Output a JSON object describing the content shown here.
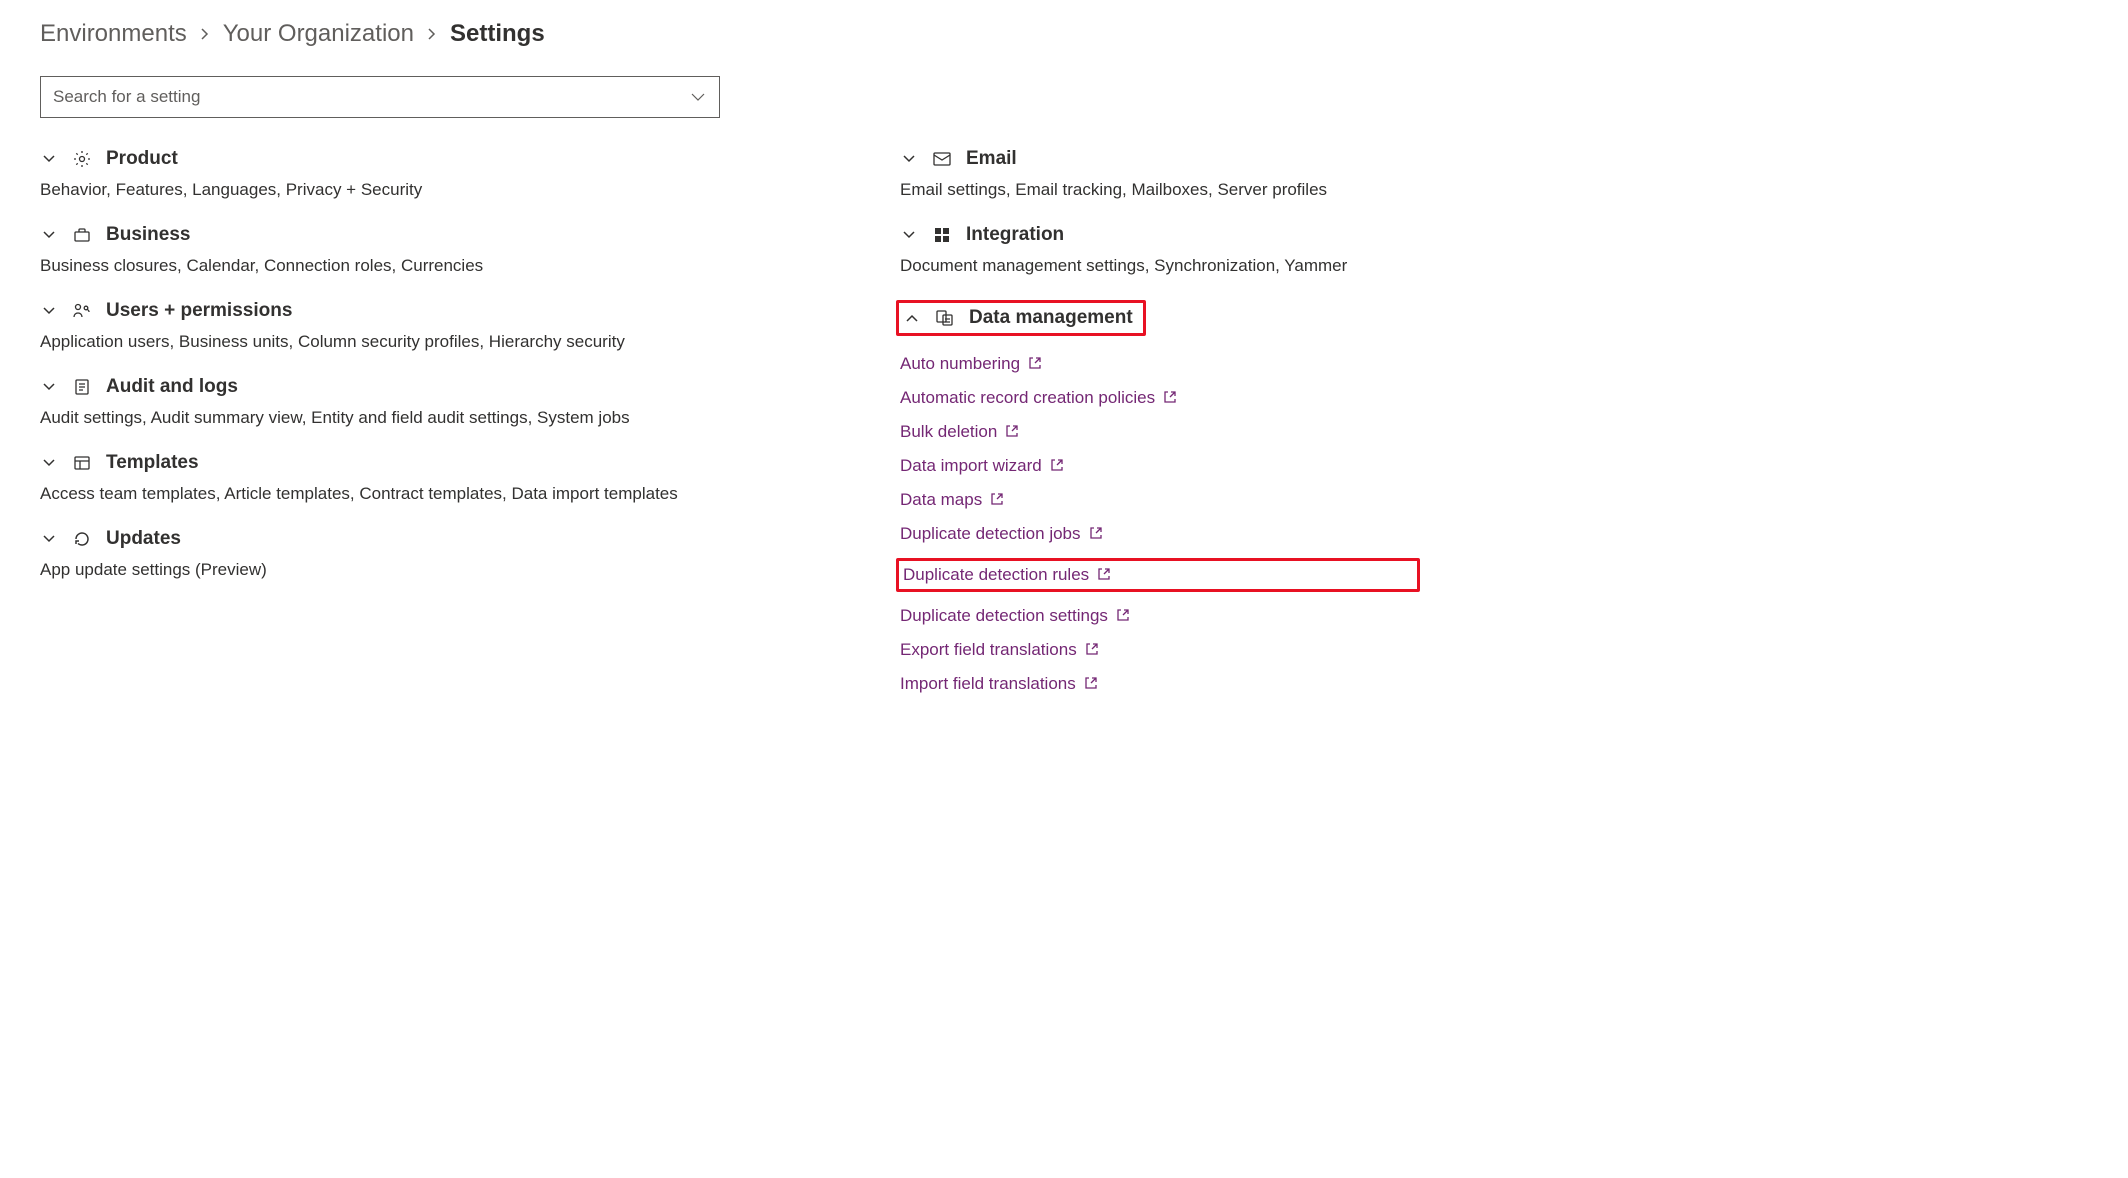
{
  "breadcrumb": {
    "items": [
      "Environments",
      "Your Organization",
      "Settings"
    ]
  },
  "search": {
    "placeholder": "Search for a setting"
  },
  "left": [
    {
      "title": "Product",
      "summary": "Behavior, Features, Languages, Privacy + Security"
    },
    {
      "title": "Business",
      "summary": "Business closures, Calendar, Connection roles, Currencies"
    },
    {
      "title": "Users + permissions",
      "summary": "Application users, Business units, Column security profiles, Hierarchy security"
    },
    {
      "title": "Audit and logs",
      "summary": "Audit settings, Audit summary view, Entity and field audit settings, System jobs"
    },
    {
      "title": "Templates",
      "summary": "Access team templates, Article templates, Contract templates, Data import templates"
    },
    {
      "title": "Updates",
      "summary": "App update settings (Preview)"
    }
  ],
  "right": {
    "email": {
      "title": "Email",
      "summary": "Email settings, Email tracking, Mailboxes, Server profiles"
    },
    "integration": {
      "title": "Integration",
      "summary": "Document management settings, Synchronization, Yammer"
    },
    "dataManagement": {
      "title": "Data management",
      "links": [
        "Auto numbering",
        "Automatic record creation policies",
        "Bulk deletion",
        "Data import wizard",
        "Data maps",
        "Duplicate detection jobs",
        "Duplicate detection rules",
        "Duplicate detection settings",
        "Export field translations",
        "Import field translations"
      ]
    }
  }
}
